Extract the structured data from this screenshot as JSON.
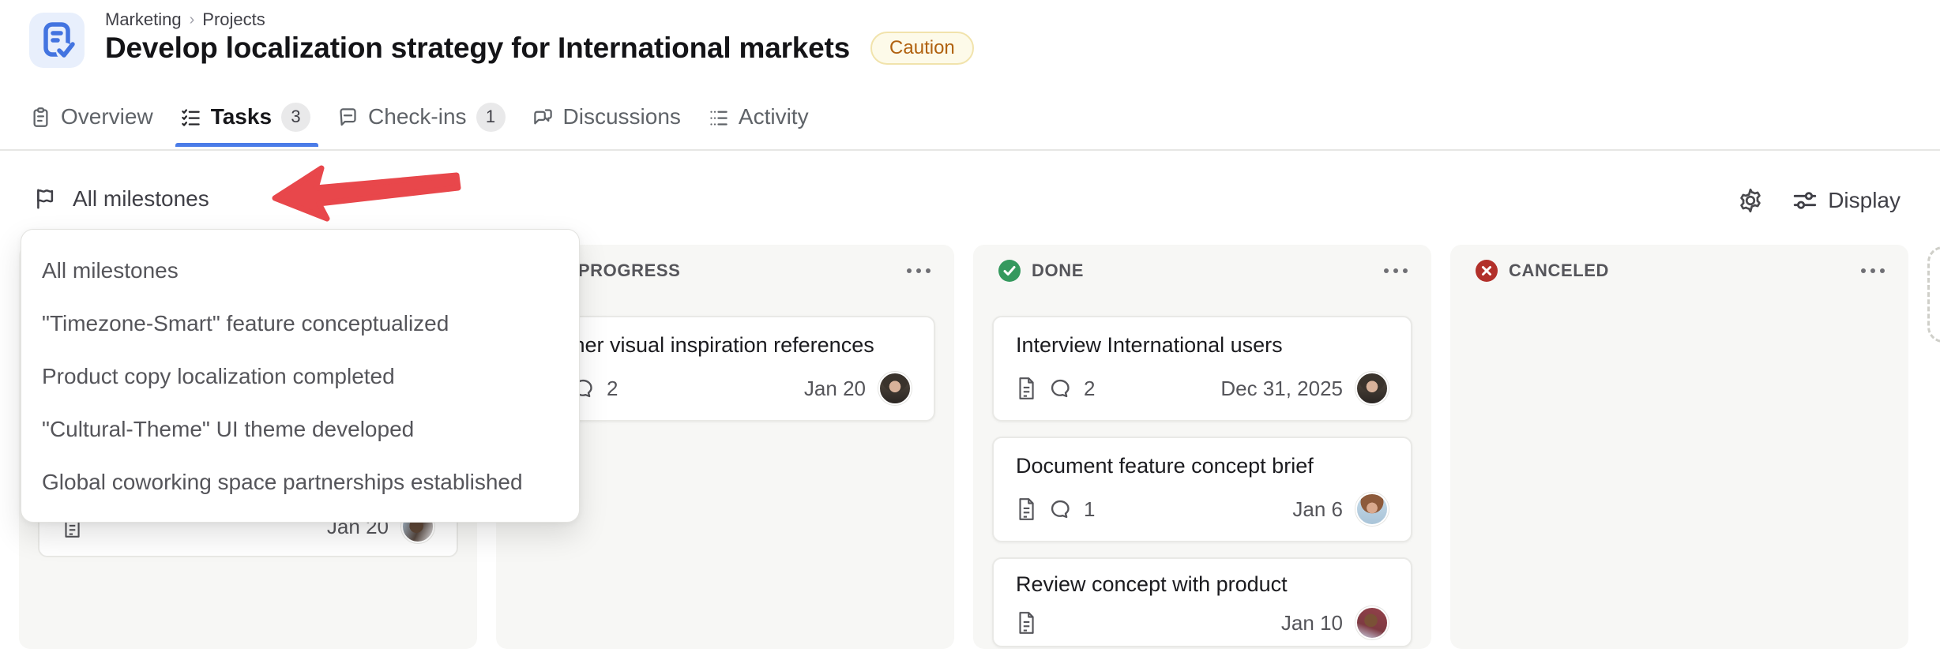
{
  "header": {
    "breadcrumb": {
      "item1": "Marketing",
      "separator": "›",
      "item2": "Projects"
    },
    "title": "Develop localization strategy for International markets",
    "status_badge": "Caution",
    "project_icon": "clipboard-check-icon"
  },
  "tabs": {
    "overview": {
      "label": "Overview"
    },
    "tasks": {
      "label": "Tasks",
      "count": "3",
      "active": true
    },
    "checkins": {
      "label": "Check-ins",
      "count": "1"
    },
    "discussions": {
      "label": "Discussions"
    },
    "activity": {
      "label": "Activity"
    }
  },
  "toolbar": {
    "milestone_filter_label": "All milestones",
    "display_label": "Display"
  },
  "milestone_dropdown": {
    "items": [
      "All milestones",
      "\"Timezone-Smart\" feature conceptualized",
      "Product copy localization completed",
      "\"Cultural-Theme\" UI theme developed",
      "Global coworking space partnerships established"
    ]
  },
  "annotation": {
    "type": "red-arrow",
    "color": "#e8474b"
  },
  "board": {
    "columns": [
      {
        "label": "",
        "cards": [
          {
            "date": "Jan 20",
            "avatar": "user-d"
          }
        ]
      },
      {
        "label": "IN PROGRESS",
        "cards": [
          {
            "title": "Gather visual inspiration references",
            "comments": "2",
            "date": "Jan 20",
            "avatar": "user-a"
          }
        ]
      },
      {
        "label": "DONE",
        "status_color": "#35995e",
        "cards": [
          {
            "title": "Interview International users",
            "comments": "2",
            "date": "Dec 31, 2025",
            "avatar": "user-a"
          },
          {
            "title": "Document feature concept brief",
            "comments": "1",
            "date": "Jan 6",
            "avatar": "user-b"
          },
          {
            "title": "Review concept with product",
            "date": "Jan 10",
            "avatar": "user-c"
          }
        ]
      },
      {
        "label": "CANCELED",
        "status_color": "#b2302a",
        "cards": []
      }
    ]
  }
}
